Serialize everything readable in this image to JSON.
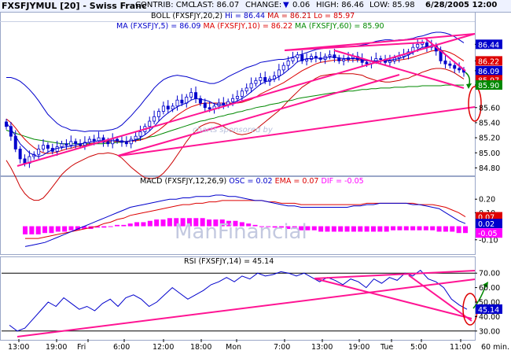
{
  "header": {
    "title": "FXSFJYMUL [20] - Swiss Franc",
    "contrib": "CONTRIB: CMC",
    "last": "LAST: 86.07",
    "change_label": "CHANGE:",
    "change_value": "0.06",
    "high": "HIGH: 86.46",
    "low": "LOW: 85.98",
    "datetime": "6/28/2005 12:00"
  },
  "price_panel": {
    "boll_title": "BOLL (FXSFJY,20,2)",
    "boll_hi": "Hi = 86.44",
    "boll_ma": "MA = 86.21",
    "boll_lo": "Lo = 85.97",
    "ma_title": "MA (FXSFJY,5) = 86.09",
    "ma10": "MA (FXSFJY,10) = 86.22",
    "ma60": "MA (FXSFJY,60) = 85.90",
    "watermark": "charts sponsored by"
  },
  "macd_panel": {
    "title": "MACD (FXSFJY,12,26,9)",
    "osc": "OSC = 0.02",
    "ema": "EMA = 0.07",
    "dif": "DIF = -0.05",
    "watermark": "ManFinancial"
  },
  "rsi_panel": {
    "title": "RSI (FXSFJY,14) = 45.14"
  },
  "x_axis": {
    "labels": [
      "13:00",
      "19:00",
      "Fri",
      "6:00",
      "12:00",
      "18:00",
      "Mon",
      "7:00",
      "13:00",
      "19:00",
      "Tue",
      "5:00",
      "11:00"
    ],
    "unit": "60 min."
  },
  "colors": {
    "candle": "#0000cc",
    "ma5": "#0000cc",
    "ma10": "#dd0000",
    "ma60": "#008800",
    "boll": "#0000cc",
    "boll_ma": "#cc0000",
    "trend": "#ff1493",
    "macd_hist": "#ff00ff",
    "macd_line": "#0000cc",
    "ema_line": "#dd0000",
    "rsi_line": "#0000cc",
    "circle": "#dd0000",
    "arrow": "#008800"
  },
  "chart_data": [
    {
      "type": "candlestick",
      "ylim": [
        84.7,
        86.6
      ],
      "yticks": [
        84.8,
        85.0,
        85.2,
        85.4,
        85.6,
        85.9,
        86.09,
        86.22,
        86.44
      ],
      "ytick_labels": [
        "84.80",
        "85.00",
        "85.20",
        "85.40",
        "85.60",
        "85.90",
        "86.09",
        "86.22",
        "86.44"
      ],
      "value_tags": [
        {
          "label": "86.44",
          "value": 86.44,
          "color": "#0000cc"
        },
        {
          "label": "86.22",
          "value": 86.22,
          "color": "#dd0000"
        },
        {
          "label": "86.09",
          "value": 86.09,
          "color": "#0000cc"
        },
        {
          "label": "85.97",
          "value": 85.97,
          "color": "#dd0000"
        },
        {
          "label": "85.90",
          "value": 85.9,
          "color": "#008800"
        }
      ],
      "close": [
        85.35,
        85.22,
        85.05,
        84.92,
        84.86,
        84.95,
        84.98,
        85.05,
        85.1,
        85.06,
        85.02,
        85.08,
        85.12,
        85.1,
        85.15,
        85.12,
        85.1,
        85.14,
        85.18,
        85.16,
        85.2,
        85.14,
        85.12,
        85.18,
        85.16,
        85.14,
        85.12,
        85.18,
        85.22,
        85.28,
        85.35,
        85.42,
        85.48,
        85.55,
        85.62,
        85.58,
        85.62,
        85.7,
        85.66,
        85.74,
        85.8,
        85.72,
        85.66,
        85.6,
        85.58,
        85.62,
        85.66,
        85.64,
        85.68,
        85.72,
        85.75,
        85.82,
        85.86,
        85.92,
        85.96,
        86.0,
        85.95,
        85.98,
        86.02,
        86.1,
        86.16,
        86.22,
        86.26,
        86.3,
        86.22,
        86.24,
        86.28,
        86.26,
        86.24,
        86.28,
        86.3,
        86.26,
        86.22,
        86.24,
        86.26,
        86.28,
        86.24,
        86.2,
        86.18,
        86.22,
        86.25,
        86.24,
        86.2,
        86.22,
        86.26,
        86.28,
        86.3,
        86.34,
        86.4,
        86.44,
        86.46,
        86.4,
        86.42,
        86.35,
        86.22,
        86.18,
        86.16,
        86.12,
        86.1,
        86.07
      ],
      "ma5": [
        85.4,
        85.32,
        85.22,
        85.12,
        85.06,
        85.0,
        84.97,
        84.95,
        84.97,
        85.01,
        85.04,
        85.06,
        85.07,
        85.08,
        85.09,
        85.1,
        85.12,
        85.13,
        85.14,
        85.15,
        85.16,
        85.16,
        85.16,
        85.16,
        85.16,
        85.15,
        85.15,
        85.16,
        85.17,
        85.2,
        85.24,
        85.29,
        85.35,
        85.42,
        85.48,
        85.53,
        85.57,
        85.61,
        85.64,
        85.66,
        85.7,
        85.72,
        85.71,
        85.7,
        85.68,
        85.65,
        85.64,
        85.63,
        85.64,
        85.66,
        85.69,
        85.72,
        85.76,
        85.81,
        85.86,
        85.91,
        85.94,
        85.96,
        85.98,
        86.01,
        86.05,
        86.1,
        86.15,
        86.21,
        86.23,
        86.25,
        86.25,
        86.26,
        86.25,
        86.26,
        86.27,
        86.27,
        86.26,
        86.25,
        86.25,
        86.25,
        86.25,
        86.24,
        86.22,
        86.22,
        86.22,
        86.22,
        86.22,
        86.23,
        86.24,
        86.25,
        86.27,
        86.3,
        86.33,
        86.37,
        86.4,
        86.41,
        86.42,
        86.41,
        86.37,
        86.31,
        86.26,
        86.2,
        86.15,
        86.09
      ],
      "ma10": [
        85.45,
        85.4,
        85.33,
        85.25,
        85.18,
        85.12,
        85.07,
        85.03,
        85.0,
        84.99,
        85.0,
        85.01,
        85.03,
        85.05,
        85.06,
        85.08,
        85.09,
        85.1,
        85.12,
        85.13,
        85.14,
        85.14,
        85.15,
        85.15,
        85.15,
        85.15,
        85.15,
        85.15,
        85.16,
        85.17,
        85.19,
        85.22,
        85.26,
        85.3,
        85.35,
        85.4,
        85.45,
        85.5,
        85.54,
        85.58,
        85.61,
        85.63,
        85.65,
        85.66,
        85.66,
        85.66,
        85.66,
        85.66,
        85.66,
        85.66,
        85.66,
        85.67,
        85.69,
        85.71,
        85.74,
        85.78,
        85.81,
        85.84,
        85.87,
        85.9,
        85.93,
        85.97,
        86.01,
        86.05,
        86.09,
        86.12,
        86.15,
        86.18,
        86.2,
        86.21,
        86.22,
        86.23,
        86.23,
        86.23,
        86.23,
        86.23,
        86.23,
        86.23,
        86.22,
        86.22,
        86.22,
        86.22,
        86.22,
        86.22,
        86.22,
        86.23,
        86.24,
        86.25,
        86.27,
        86.29,
        86.31,
        86.33,
        86.35,
        86.36,
        86.36,
        86.35,
        86.33,
        86.3,
        86.26,
        86.22
      ],
      "ma60": [
        85.3,
        85.28,
        85.26,
        85.24,
        85.22,
        85.2,
        85.18,
        85.17,
        85.16,
        85.15,
        85.14,
        85.13,
        85.12,
        85.12,
        85.12,
        85.12,
        85.12,
        85.12,
        85.12,
        85.12,
        85.12,
        85.12,
        85.13,
        85.13,
        85.14,
        85.14,
        85.15,
        85.16,
        85.17,
        85.18,
        85.19,
        85.21,
        85.22,
        85.24,
        85.26,
        85.28,
        85.3,
        85.32,
        85.34,
        85.36,
        85.38,
        85.4,
        85.42,
        85.43,
        85.45,
        85.46,
        85.48,
        85.49,
        85.51,
        85.52,
        85.54,
        85.55,
        85.57,
        85.58,
        85.6,
        85.61,
        85.62,
        85.64,
        85.65,
        85.66,
        85.68,
        85.69,
        85.7,
        85.72,
        85.73,
        85.74,
        85.75,
        85.76,
        85.77,
        85.78,
        85.79,
        85.8,
        85.8,
        85.81,
        85.82,
        85.82,
        85.83,
        85.84,
        85.84,
        85.85,
        85.85,
        85.86,
        85.86,
        85.86,
        85.87,
        85.87,
        85.87,
        85.88,
        85.88,
        85.88,
        85.89,
        85.89,
        85.89,
        85.89,
        85.89,
        85.9,
        85.9,
        85.9,
        85.9,
        85.9
      ],
      "boll_width": [
        0.55,
        0.6,
        0.65,
        0.7,
        0.72,
        0.72,
        0.7,
        0.66,
        0.6,
        0.52,
        0.45,
        0.38,
        0.32,
        0.28,
        0.24,
        0.22,
        0.2,
        0.18,
        0.17,
        0.16,
        0.15,
        0.15,
        0.15,
        0.16,
        0.18,
        0.22,
        0.28,
        0.34,
        0.4,
        0.46,
        0.52,
        0.56,
        0.6,
        0.62,
        0.62,
        0.6,
        0.57,
        0.53,
        0.48,
        0.43,
        0.38,
        0.34,
        0.3,
        0.28,
        0.26,
        0.26,
        0.28,
        0.31,
        0.35,
        0.38,
        0.41,
        0.43,
        0.44,
        0.44,
        0.43,
        0.42,
        0.4,
        0.38,
        0.36,
        0.34,
        0.31,
        0.28,
        0.26,
        0.24,
        0.22,
        0.21,
        0.2,
        0.19,
        0.18,
        0.18,
        0.18,
        0.18,
        0.18,
        0.18,
        0.18,
        0.18,
        0.19,
        0.2,
        0.22,
        0.24,
        0.26,
        0.27,
        0.28,
        0.28,
        0.27,
        0.27,
        0.26,
        0.26,
        0.25,
        0.25,
        0.24,
        0.24,
        0.24,
        0.24,
        0.24,
        0.24,
        0.24,
        0.24,
        0.24,
        0.24
      ]
    },
    {
      "type": "bar",
      "ylim": [
        -0.2,
        0.3
      ],
      "yticks": [
        0.2,
        0.1,
        -0.1
      ],
      "ytick_labels": [
        "0.20",
        "0.10",
        "-0.10"
      ],
      "value_tags": [
        {
          "label": "0.07",
          "value": 0.07,
          "color": "#dd0000"
        },
        {
          "label": "0.02",
          "value": 0.02,
          "color": "#0000cc"
        },
        {
          "label": "-0.05",
          "value": -0.05,
          "color": "#ff00ff"
        }
      ],
      "osc": [
        -0.06,
        -0.06,
        -0.06,
        -0.05,
        -0.05,
        -0.04,
        -0.04,
        -0.03,
        -0.03,
        -0.02,
        -0.02,
        -0.01,
        -0.01,
        0.0,
        0.01,
        0.01,
        0.02,
        0.03,
        0.03,
        0.04,
        0.05,
        0.05,
        0.06,
        0.06,
        0.06,
        0.06,
        0.06,
        0.06,
        0.05,
        0.05,
        0.05,
        0.04,
        0.04,
        0.03,
        0.02,
        0.01,
        0.0,
        0.0,
        -0.01,
        -0.01,
        -0.02,
        -0.02,
        -0.03,
        -0.03,
        -0.03,
        -0.04,
        -0.04,
        -0.04,
        -0.04,
        -0.04,
        -0.04,
        -0.04,
        -0.04,
        -0.04,
        -0.04,
        -0.04,
        -0.03,
        -0.03,
        -0.03,
        -0.03,
        -0.03,
        -0.03,
        -0.03,
        -0.04,
        -0.04,
        -0.04,
        -0.05,
        -0.05
      ],
      "macd": [
        -0.15,
        -0.14,
        -0.13,
        -0.12,
        -0.1,
        -0.08,
        -0.06,
        -0.04,
        -0.02,
        0.0,
        0.02,
        0.04,
        0.06,
        0.08,
        0.1,
        0.12,
        0.14,
        0.15,
        0.16,
        0.17,
        0.18,
        0.19,
        0.2,
        0.2,
        0.21,
        0.21,
        0.22,
        0.22,
        0.22,
        0.23,
        0.23,
        0.22,
        0.22,
        0.21,
        0.2,
        0.19,
        0.19,
        0.18,
        0.17,
        0.16,
        0.15,
        0.15,
        0.14,
        0.14,
        0.14,
        0.14,
        0.14,
        0.14,
        0.14,
        0.14,
        0.15,
        0.15,
        0.16,
        0.16,
        0.17,
        0.17,
        0.17,
        0.17,
        0.17,
        0.16,
        0.16,
        0.15,
        0.14,
        0.13,
        0.1,
        0.07,
        0.04,
        0.02
      ],
      "ema": [
        -0.09,
        -0.09,
        -0.09,
        -0.08,
        -0.07,
        -0.06,
        -0.05,
        -0.04,
        -0.03,
        -0.02,
        -0.01,
        0.0,
        0.02,
        0.03,
        0.05,
        0.06,
        0.08,
        0.09,
        0.1,
        0.11,
        0.12,
        0.13,
        0.14,
        0.15,
        0.16,
        0.16,
        0.17,
        0.17,
        0.18,
        0.18,
        0.19,
        0.19,
        0.19,
        0.19,
        0.19,
        0.19,
        0.19,
        0.18,
        0.18,
        0.17,
        0.17,
        0.17,
        0.16,
        0.16,
        0.16,
        0.16,
        0.16,
        0.16,
        0.16,
        0.16,
        0.16,
        0.16,
        0.17,
        0.17,
        0.17,
        0.17,
        0.17,
        0.17,
        0.17,
        0.17,
        0.16,
        0.16,
        0.16,
        0.15,
        0.14,
        0.12,
        0.1,
        0.07
      ]
    },
    {
      "type": "line",
      "ylim": [
        25,
        75
      ],
      "yticks": [
        70.0,
        60.0,
        50.0,
        40.0,
        30.0
      ],
      "ytick_labels": [
        "70.00",
        "60.00",
        "50.00",
        "40.00",
        "30.00"
      ],
      "hlines": [
        70,
        30
      ],
      "value_tags": [
        {
          "label": "45.14",
          "value": 45.14,
          "color": "#0000cc"
        }
      ],
      "values": [
        34,
        30,
        32,
        38,
        44,
        50,
        47,
        53,
        49,
        45,
        47,
        44,
        49,
        52,
        47,
        53,
        55,
        52,
        47,
        50,
        55,
        60,
        56,
        52,
        55,
        58,
        62,
        64,
        67,
        64,
        68,
        66,
        70,
        68,
        69,
        71,
        70,
        68,
        70,
        67,
        64,
        67,
        65,
        62,
        66,
        64,
        60,
        66,
        63,
        67,
        65,
        70,
        68,
        72,
        66,
        64,
        60,
        52,
        48,
        45
      ]
    }
  ]
}
